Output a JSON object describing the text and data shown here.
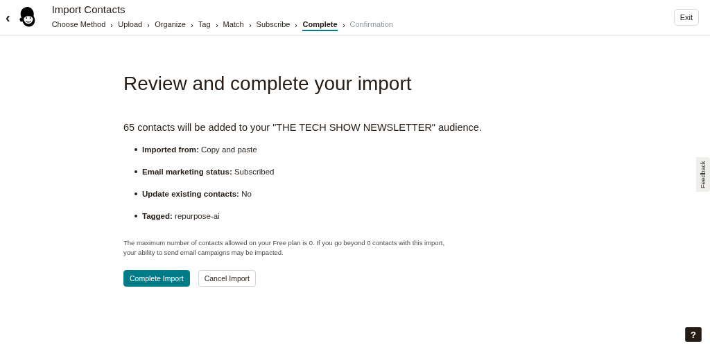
{
  "header": {
    "title": "Import Contacts",
    "back": "‹",
    "exit": "Exit"
  },
  "steps": [
    {
      "label": "Choose Method",
      "selected": false,
      "disabled": false
    },
    {
      "label": "Upload",
      "selected": false,
      "disabled": false
    },
    {
      "label": "Organize",
      "selected": false,
      "disabled": false
    },
    {
      "label": "Tag",
      "selected": false,
      "disabled": false
    },
    {
      "label": "Match",
      "selected": false,
      "disabled": false
    },
    {
      "label": "Subscribe",
      "selected": false,
      "disabled": false
    },
    {
      "label": "Complete",
      "selected": true,
      "disabled": false
    },
    {
      "label": "Confirmation",
      "selected": false,
      "disabled": true
    }
  ],
  "main": {
    "heading": "Review and complete your import",
    "summary": "65 contacts will be added to your \"THE TECH SHOW NEWSLETTER\" audience.",
    "details": [
      "**Imported from:** Copy and paste",
      "**Email marketing status:** Subscribed",
      "**Update existing contacts:** No",
      "**Tagged:** repurpose-ai"
    ],
    "note": "The maximum number of contacts allowed on your Free plan is 0. If you go beyond 0 contacts with this import, your ability to send email campaigns may be impacted.",
    "buttons": [
      {
        "label": "Complete Import",
        "kind": "primary"
      },
      {
        "label": "Cancel Import",
        "kind": "secondary"
      }
    ]
  },
  "feedback": "Feedback",
  "help": "?"
}
